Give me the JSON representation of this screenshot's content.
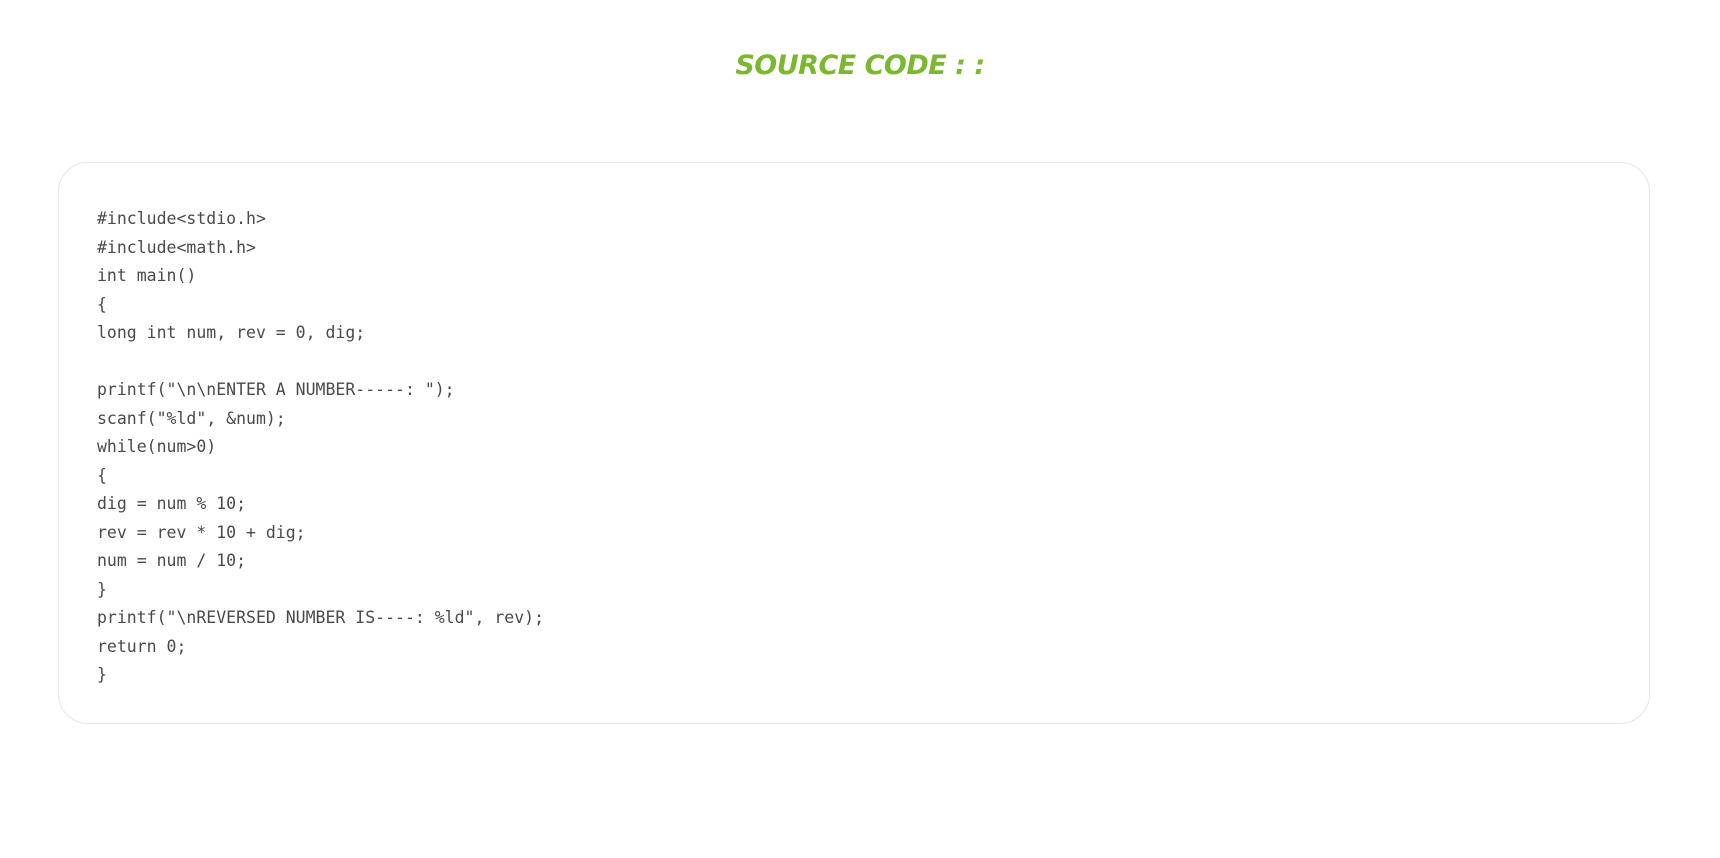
{
  "page": {
    "heading": "SOURCE CODE : :",
    "accent_color": "#7cb82f",
    "code_text_color": "#4a4a4a"
  },
  "code": {
    "language": "c",
    "lines": [
      "#include<stdio.h>",
      "#include<math.h>",
      "int main()",
      "{",
      "long int num, rev = 0, dig;",
      "",
      "printf(\"\\n\\nENTER A NUMBER-----: \");",
      "scanf(\"%ld\", &num);",
      "while(num>0)",
      "{",
      "dig = num % 10;",
      "rev = rev * 10 + dig;",
      "num = num / 10;",
      "}",
      "printf(\"\\nREVERSED NUMBER IS----: %ld\", rev);",
      "return 0;",
      "}"
    ]
  }
}
